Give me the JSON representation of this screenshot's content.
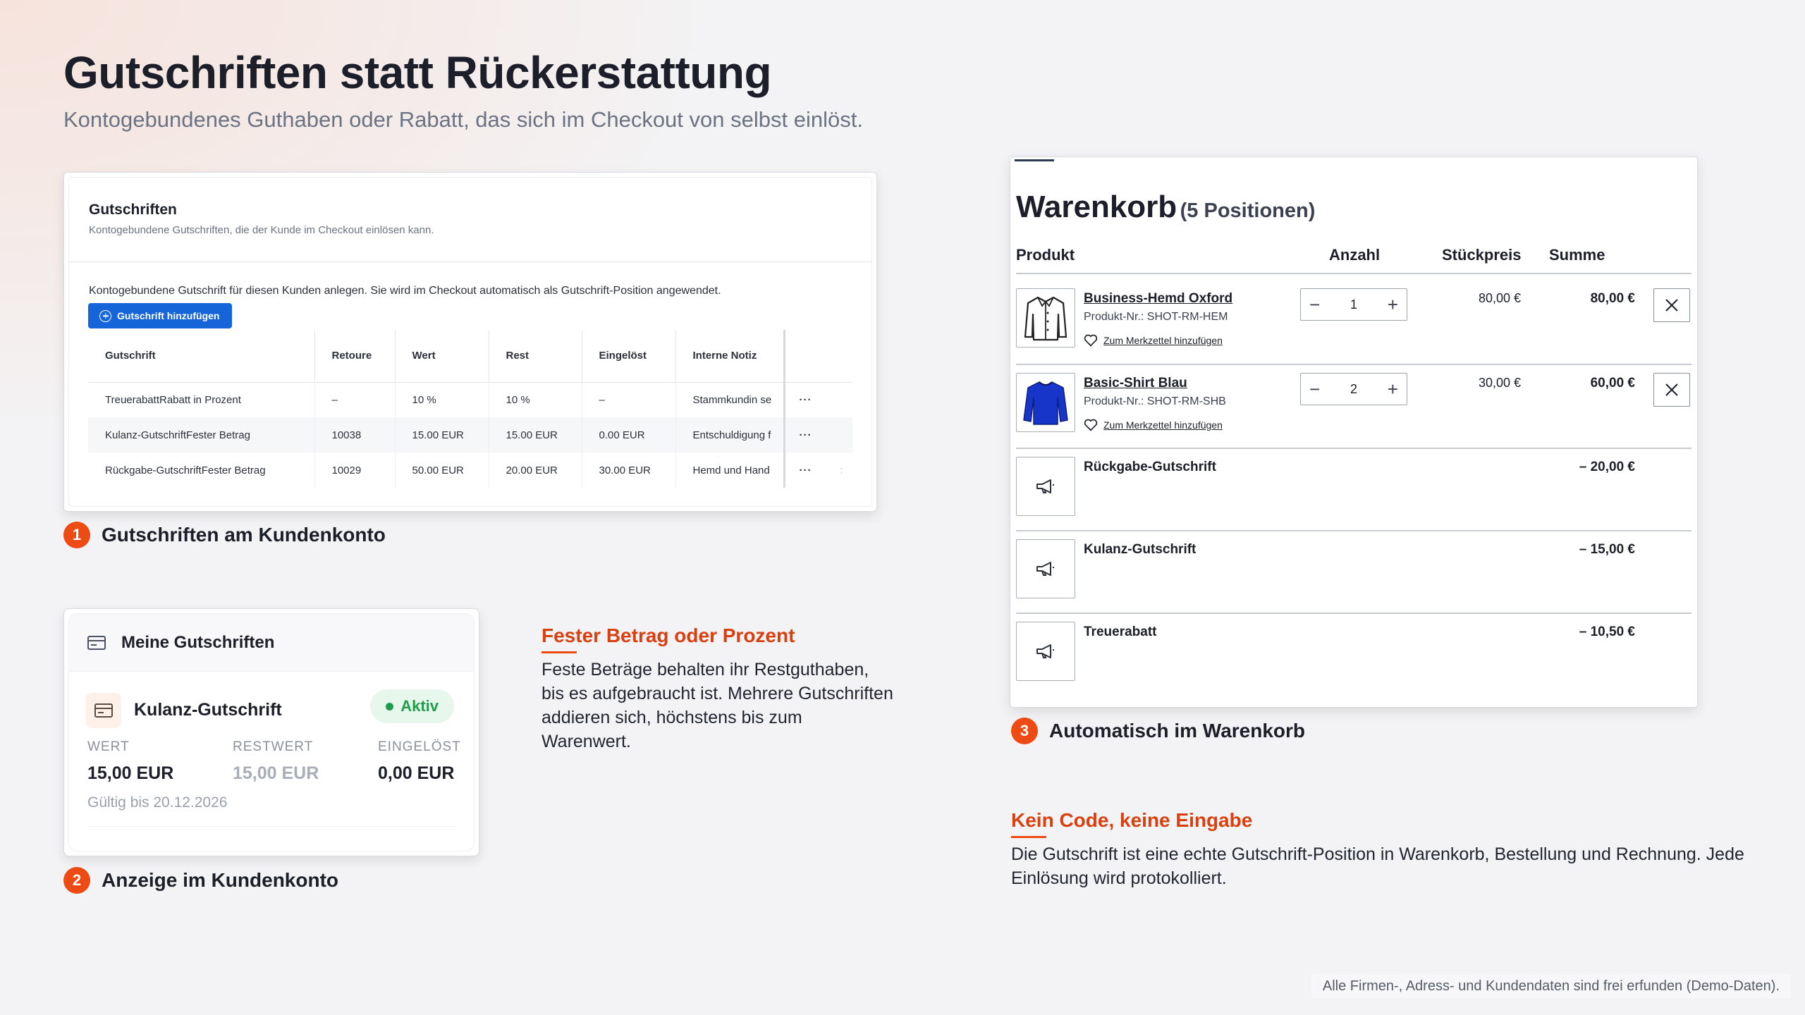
{
  "page": {
    "title": "Gutschriften statt Rückerstattung",
    "subtitle": "Kontogebundenes Guthaben oder Rabatt, das sich im Checkout von selbst einlöst."
  },
  "admin": {
    "title": "Gutschriften",
    "subtitle": "Kontogebundene Gutschriften, die der Kunde im Checkout einlösen kann.",
    "description": "Kontogebundene Gutschrift für diesen Kunden anlegen. Sie wird im Checkout automatisch als Gutschrift-Position angewendet.",
    "add_button": "Gutschrift hinzufügen",
    "columns": [
      "Gutschrift",
      "Retoure",
      "Wert",
      "Rest",
      "Eingelöst",
      "Interne Notiz"
    ],
    "rows": [
      {
        "gutschrift": "TreuerabattRabatt in Prozent",
        "retoure": "–",
        "wert": "10 %",
        "rest": "10 %",
        "eingeloest": "–",
        "notiz": "Stammkundin se",
        "actions": "···"
      },
      {
        "gutschrift": "Kulanz-GutschriftFester Betrag",
        "retoure": "10038",
        "wert": "15.00 EUR",
        "rest": "15.00 EUR",
        "eingeloest": "0.00 EUR",
        "notiz": "Entschuldigung f",
        "actions": "···"
      },
      {
        "gutschrift": "Rückgabe-GutschriftFester Betrag",
        "retoure": "10029",
        "wert": "50.00 EUR",
        "rest": "20.00 EUR",
        "eingeloest": "30.00 EUR",
        "notiz": "Hemd und Hand",
        "actions": "···"
      }
    ],
    "row_trail": ":"
  },
  "steps": {
    "s1": {
      "num": "1",
      "label": "Gutschriften am Kundenkonto"
    },
    "s2": {
      "num": "2",
      "label": "Anzeige im Kundenkonto"
    },
    "s3": {
      "num": "3",
      "label": "Automatisch im Warenkorb"
    }
  },
  "customer": {
    "title": "Meine Gutschriften",
    "item_title": "Kulanz-Gutschrift",
    "badge": "Aktiv",
    "labels": {
      "wert": "WERT",
      "restwert": "RESTWERT",
      "eingeloest": "EINGELÖST"
    },
    "values": {
      "wert": "15,00 EUR",
      "restwert": "15,00 EUR",
      "eingeloest": "0,00 EUR"
    },
    "valid": "Gültig bis 20.12.2026"
  },
  "features": {
    "f1": {
      "heading": "Fester Betrag oder Prozent",
      "text": "Feste Beträge behalten ihr Restguthaben, bis es aufgebraucht ist. Mehrere Gutschriften addieren sich, höchstens bis zum Warenwert."
    },
    "f2": {
      "heading": "Kein Code, keine Eingabe",
      "text": "Die Gutschrift ist eine echte Gutschrift-Position in Warenkorb, Bestellung und Rechnung. Jede Einlösung wird protokolliert."
    }
  },
  "cart": {
    "title": "Warenkorb",
    "count": "(5 Positionen)",
    "headers": {
      "produkt": "Produkt",
      "anzahl": "Anzahl",
      "stueckpreis": "Stückpreis",
      "summe": "Summe"
    },
    "products": [
      {
        "name": "Business-Hemd Oxford",
        "sku": "Produkt-Nr.: SHOT-RM-HEM",
        "wishlist": "Zum Merkzettel hinzufügen",
        "qty": "1",
        "price": "80,00 €",
        "sum": "80,00 €",
        "icon": "shirt-outline-icon"
      },
      {
        "name": "Basic-Shirt Blau",
        "sku": "Produkt-Nr.: SHOT-RM-SHB",
        "wishlist": "Zum Merkzettel hinzufügen",
        "qty": "2",
        "price": "30,00 €",
        "sum": "60,00 €",
        "icon": "blue-shirt-icon"
      }
    ],
    "credits": [
      {
        "name": "Rückgabe-Gutschrift",
        "sum": "– 20,00 €",
        "icon": "megaphone-icon"
      },
      {
        "name": "Kulanz-Gutschrift",
        "sum": "– 15,00 €",
        "icon": "megaphone-icon"
      },
      {
        "name": "Treuerabatt",
        "sum": "– 10,50 €",
        "icon": "megaphone-icon"
      }
    ],
    "minus": "−",
    "plus": "+"
  },
  "footer": "Alle Firmen-, Adress- und Kundendaten sind frei erfunden (Demo-Daten).",
  "colors": {
    "accent": "#ee4a14",
    "heading_accent": "#d8400f",
    "button_blue": "#1565d8",
    "active_green": "#1f9d4d"
  }
}
